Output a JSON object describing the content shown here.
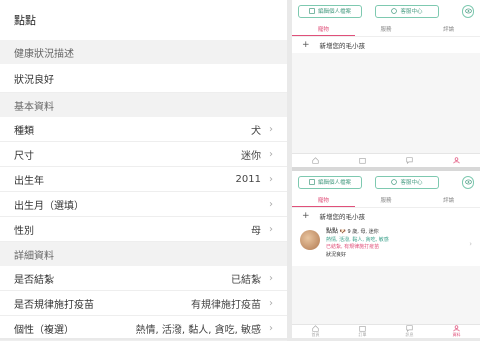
{
  "left": {
    "title": "點點",
    "health_header": "健康狀況描述",
    "health_value": "狀況良好",
    "basic_header": "基本資料",
    "basic_rows": [
      {
        "label": "種類",
        "value": "犬"
      },
      {
        "label": "尺寸",
        "value": "迷你"
      },
      {
        "label": "出生年",
        "value": "2011"
      },
      {
        "label": "出生月（選填）",
        "value": ""
      },
      {
        "label": "性別",
        "value": "母"
      }
    ],
    "detail_header": "詳細資料",
    "detail_rows": [
      {
        "label": "是否結紮",
        "value": "已結紮"
      },
      {
        "label": "是否規律施打疫苗",
        "value": "有規律施打疫苗"
      },
      {
        "label": "個性（複選）",
        "value": "熱情, 活潑, 黏人, 貪吃, 敏感"
      }
    ]
  },
  "panel": {
    "edit_profile": "編輯個人檔案",
    "help_center": "客服中心",
    "tabs": [
      "寵物",
      "服務",
      "評論"
    ],
    "add_pet": "新增您的毛小孩",
    "nav": [
      "首頁",
      "訂單",
      "訊息",
      "資料"
    ]
  },
  "pet": {
    "name": "點點",
    "meta": "9 歲, 母, 迷你",
    "traits": "熱情, 活潑, 黏人, 貪吃, 敏感",
    "vaccine": "已結紮, 有規律施打疫苗",
    "health": "狀況良好"
  },
  "colors": {
    "accent": "#e0507a",
    "green": "#4a9d83"
  }
}
